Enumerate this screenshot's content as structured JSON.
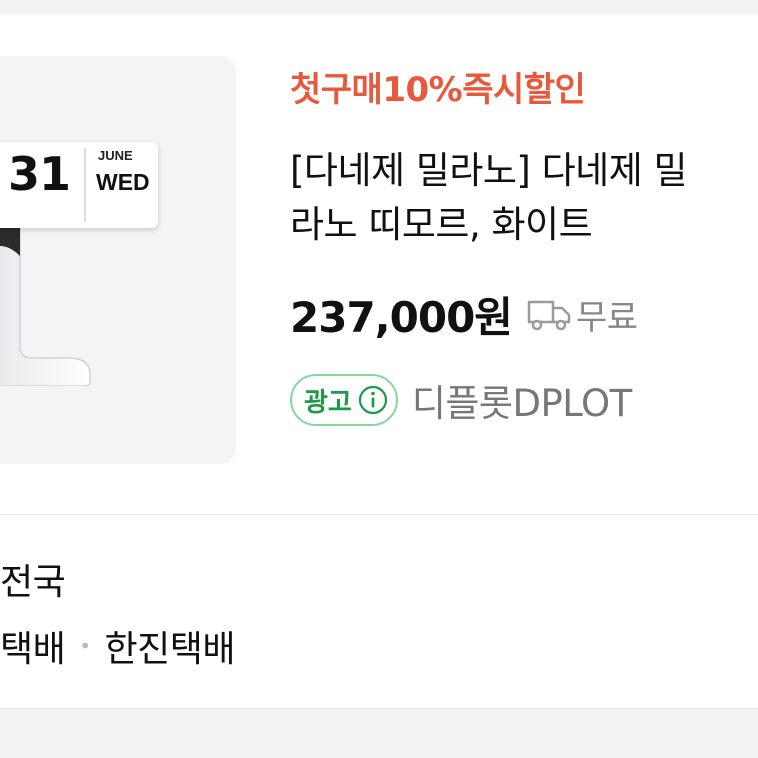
{
  "product": {
    "image_calendar": {
      "day": "31",
      "month": "JUNE",
      "weekday": "WED"
    },
    "promo_label": "첫구매10%즉시할인",
    "title_line1": "[다네제 밀라노] 다네제 밀",
    "title_line2": "라노 띠모르, 화이트",
    "price": "237,000원",
    "shipping_icon": "truck-icon",
    "shipping_label": "무료",
    "ad_badge_label": "광고",
    "ad_info_icon": "info-icon",
    "seller": "디플롯DPLOT"
  },
  "delivery": {
    "region": "전국",
    "couriers": [
      "택배",
      "한진택배"
    ],
    "separator": "•"
  },
  "colors": {
    "promo": "#e8583a",
    "ad_green": "#1d9b47",
    "ad_border": "#86d79b",
    "muted": "#888888"
  }
}
